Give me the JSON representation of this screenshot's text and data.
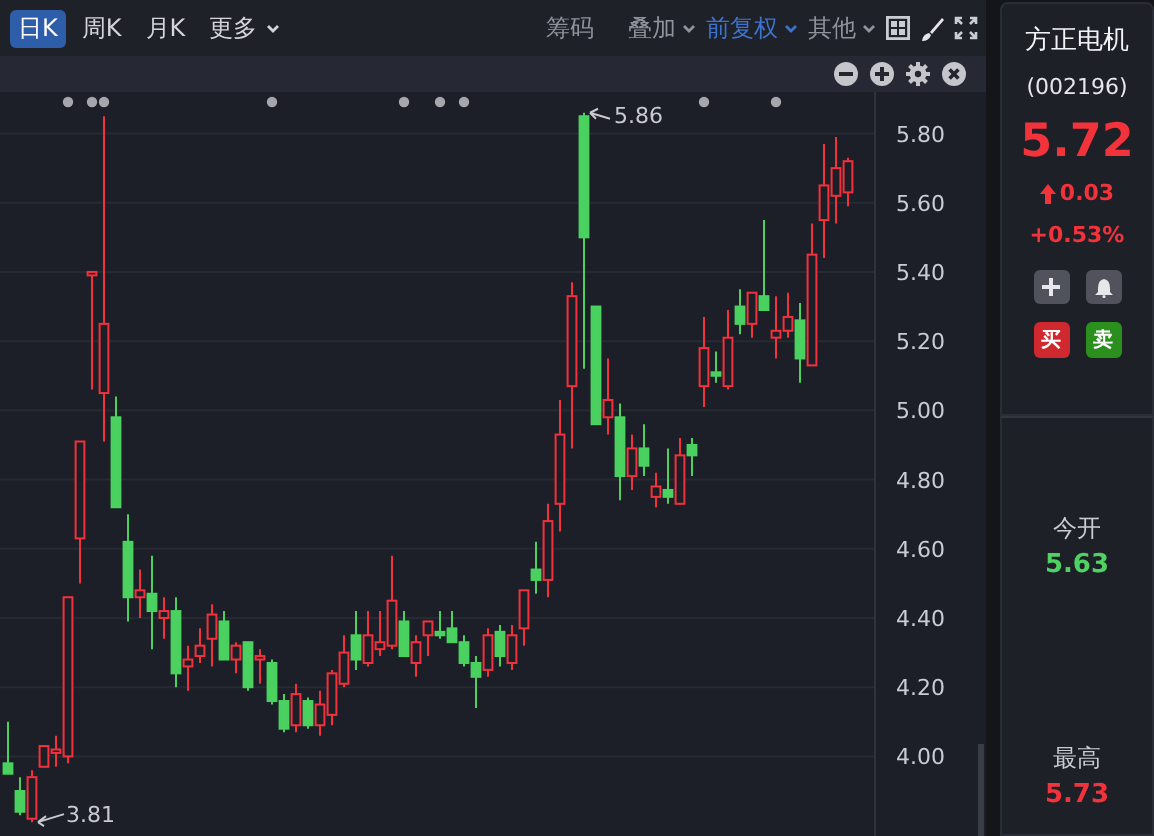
{
  "toolbar": {
    "tabs": [
      {
        "label": "日K",
        "selected": true,
        "dropdown": false
      },
      {
        "label": "周K",
        "selected": false,
        "dropdown": false
      },
      {
        "label": "月K",
        "selected": false,
        "dropdown": false
      },
      {
        "label": "更多",
        "selected": false,
        "dropdown": true
      }
    ],
    "tools": [
      {
        "label": "筹码",
        "active": false,
        "dropdown": false
      },
      {
        "label": "叠加",
        "active": false,
        "dropdown": true
      },
      {
        "label": "前复权",
        "active": true,
        "dropdown": true
      },
      {
        "label": "其他",
        "active": false,
        "dropdown": true
      }
    ]
  },
  "chart": {
    "high_marker": "5.86",
    "low_marker": "3.81",
    "chart_data": {
      "type": "candlestick",
      "grid": true,
      "ylim": [
        3.77,
        5.92
      ],
      "yticks": [
        {
          "value": 5.8,
          "label": "5.80"
        },
        {
          "value": 5.6,
          "label": "5.60"
        },
        {
          "value": 5.4,
          "label": "5.40"
        },
        {
          "value": 5.2,
          "label": "5.20"
        },
        {
          "value": 5.0,
          "label": "5.00"
        },
        {
          "value": 4.8,
          "label": "4.80"
        },
        {
          "value": 4.6,
          "label": "4.60"
        },
        {
          "value": 4.4,
          "label": "4.40"
        },
        {
          "value": 4.2,
          "label": "4.20"
        },
        {
          "value": 4.0,
          "label": "4.00"
        }
      ],
      "ohlc": [
        [
          3.98,
          4.1,
          3.95,
          3.95
        ],
        [
          3.9,
          3.94,
          3.83,
          3.84
        ],
        [
          3.82,
          3.96,
          3.81,
          3.94
        ],
        [
          3.97,
          4.03,
          3.97,
          4.03
        ],
        [
          4.01,
          4.06,
          3.97,
          4.02
        ],
        [
          4.0,
          4.46,
          3.98,
          4.46
        ],
        [
          4.63,
          4.91,
          4.5,
          4.91
        ],
        [
          5.39,
          5.4,
          5.06,
          5.4
        ],
        [
          5.05,
          5.85,
          4.91,
          5.25
        ],
        [
          4.98,
          5.04,
          4.72,
          4.72
        ],
        [
          4.62,
          4.7,
          4.39,
          4.46
        ],
        [
          4.46,
          4.54,
          4.4,
          4.48
        ],
        [
          4.47,
          4.58,
          4.31,
          4.42
        ],
        [
          4.4,
          4.46,
          4.34,
          4.42
        ],
        [
          4.42,
          4.46,
          4.2,
          4.24
        ],
        [
          4.26,
          4.32,
          4.19,
          4.28
        ],
        [
          4.29,
          4.37,
          4.27,
          4.32
        ],
        [
          4.34,
          4.44,
          4.26,
          4.41
        ],
        [
          4.39,
          4.42,
          4.28,
          4.28
        ],
        [
          4.28,
          4.33,
          4.24,
          4.32
        ],
        [
          4.33,
          4.33,
          4.19,
          4.2
        ],
        [
          4.28,
          4.31,
          4.21,
          4.29
        ],
        [
          4.27,
          4.28,
          4.15,
          4.16
        ],
        [
          4.16,
          4.18,
          4.07,
          4.08
        ],
        [
          4.09,
          4.21,
          4.07,
          4.18
        ],
        [
          4.16,
          4.17,
          4.08,
          4.09
        ],
        [
          4.09,
          4.19,
          4.06,
          4.15
        ],
        [
          4.12,
          4.25,
          4.09,
          4.24
        ],
        [
          4.21,
          4.35,
          4.2,
          4.3
        ],
        [
          4.35,
          4.42,
          4.25,
          4.28
        ],
        [
          4.27,
          4.42,
          4.26,
          4.35
        ],
        [
          4.31,
          4.42,
          4.29,
          4.33
        ],
        [
          4.32,
          4.58,
          4.31,
          4.45
        ],
        [
          4.39,
          4.42,
          4.29,
          4.29
        ],
        [
          4.27,
          4.35,
          4.23,
          4.33
        ],
        [
          4.35,
          4.39,
          4.29,
          4.39
        ],
        [
          4.36,
          4.42,
          4.34,
          4.35
        ],
        [
          4.37,
          4.42,
          4.33,
          4.33
        ],
        [
          4.33,
          4.35,
          4.26,
          4.27
        ],
        [
          4.27,
          4.29,
          4.14,
          4.23
        ],
        [
          4.25,
          4.37,
          4.23,
          4.35
        ],
        [
          4.36,
          4.38,
          4.26,
          4.29
        ],
        [
          4.27,
          4.38,
          4.25,
          4.35
        ],
        [
          4.37,
          4.48,
          4.32,
          4.48
        ],
        [
          4.54,
          4.62,
          4.47,
          4.51
        ],
        [
          4.51,
          4.73,
          4.46,
          4.68
        ],
        [
          4.73,
          5.03,
          4.65,
          4.93
        ],
        [
          5.07,
          5.37,
          4.89,
          5.33
        ],
        [
          5.85,
          5.86,
          5.12,
          5.5
        ],
        [
          5.3,
          5.3,
          4.96,
          4.96
        ],
        [
          4.98,
          5.15,
          4.93,
          5.03
        ],
        [
          4.98,
          5.02,
          4.74,
          4.81
        ],
        [
          4.81,
          4.93,
          4.77,
          4.89
        ],
        [
          4.89,
          4.96,
          4.81,
          4.84
        ],
        [
          4.75,
          4.82,
          4.72,
          4.78
        ],
        [
          4.77,
          4.89,
          4.73,
          4.75
        ],
        [
          4.73,
          4.92,
          4.73,
          4.87
        ],
        [
          4.9,
          4.92,
          4.81,
          4.87
        ],
        [
          5.07,
          5.27,
          5.01,
          5.18
        ],
        [
          5.11,
          5.17,
          5.08,
          5.1
        ],
        [
          5.07,
          5.29,
          5.06,
          5.21
        ],
        [
          5.3,
          5.35,
          5.22,
          5.25
        ],
        [
          5.25,
          5.34,
          5.21,
          5.34
        ],
        [
          5.33,
          5.55,
          5.29,
          5.29
        ],
        [
          5.21,
          5.33,
          5.15,
          5.23
        ],
        [
          5.23,
          5.34,
          5.21,
          5.27
        ],
        [
          5.26,
          5.31,
          5.08,
          5.15
        ],
        [
          5.13,
          5.54,
          5.13,
          5.45
        ],
        [
          5.55,
          5.77,
          5.44,
          5.65
        ],
        [
          5.62,
          5.79,
          5.54,
          5.7
        ],
        [
          5.63,
          5.73,
          5.59,
          5.72
        ]
      ]
    }
  },
  "quote": {
    "name": "方正电机",
    "code": "(002196)",
    "price": "5.72",
    "color": "#f2333c",
    "change": "0.03",
    "change_percent": "+0.53%",
    "trade_buttons": [
      {
        "label": "买",
        "kind": "buy"
      },
      {
        "label": "卖",
        "kind": "sell"
      }
    ]
  },
  "stats": [
    {
      "label": "今开",
      "value": "5.63",
      "color": "#4fd263"
    },
    {
      "label": "最高",
      "value": "5.73",
      "color": "#f2333c"
    }
  ]
}
